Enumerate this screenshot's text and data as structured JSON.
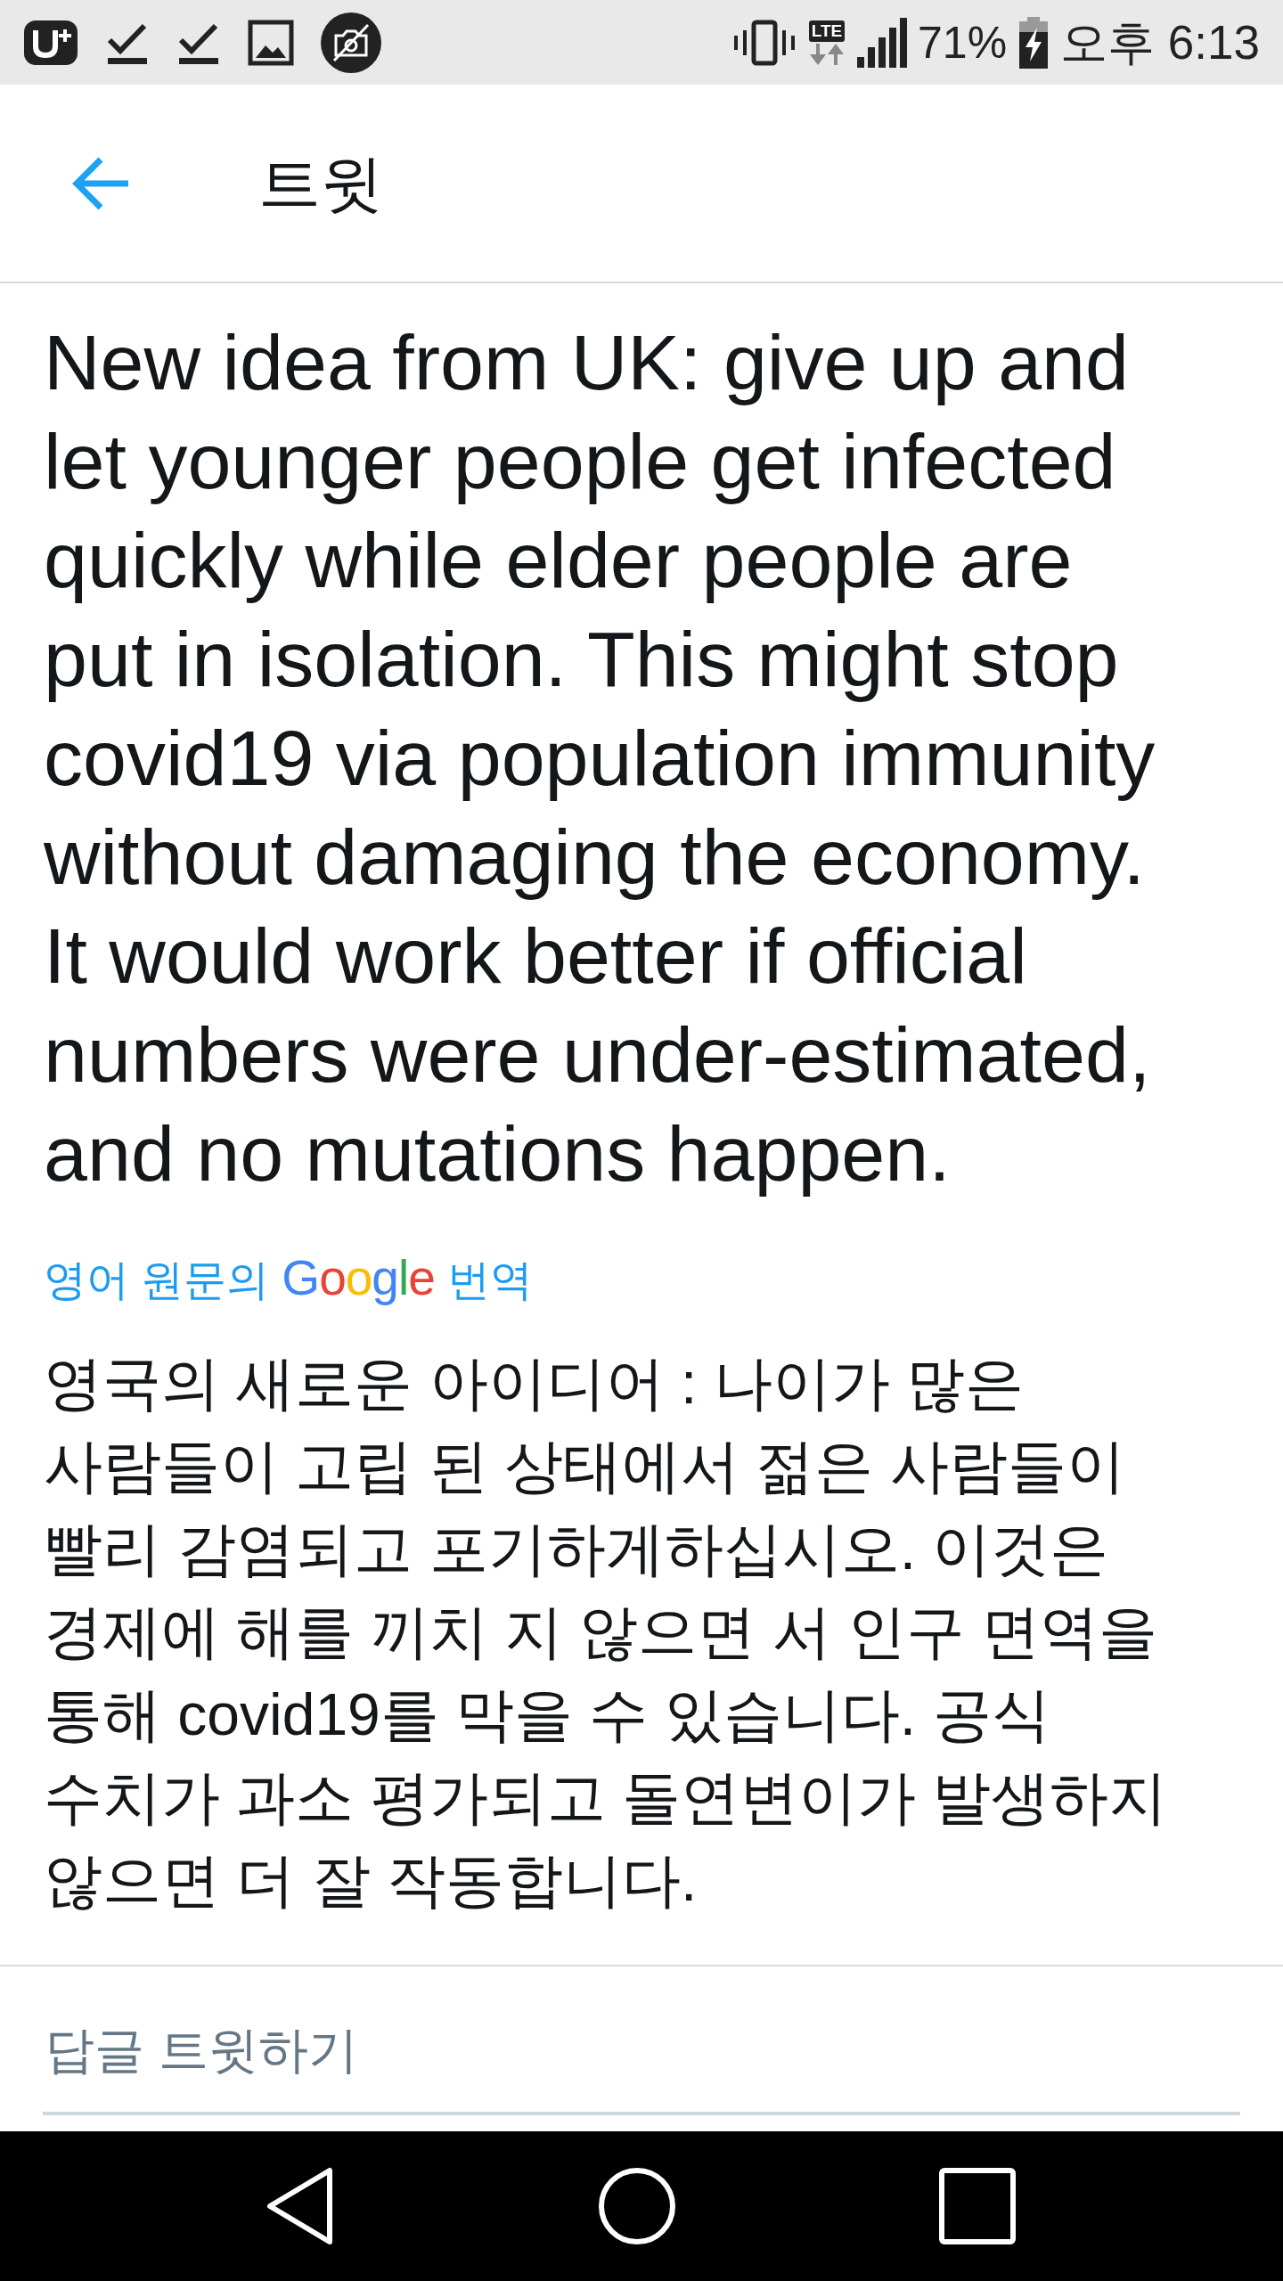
{
  "status_bar": {
    "network_type": "LTE",
    "battery": "71%",
    "time": "오후 6:13"
  },
  "header": {
    "title": "트윗"
  },
  "tweet": {
    "text": "New idea from UK: give up and let younger people get infected quickly while elder people are put in isolation. This might stop covid19 via population immunity without damaging the economy. It would work better if official numbers were under-estimated, and no mutations happen.",
    "translation_credit": {
      "prefix": "영어 원문의",
      "logo": "Google",
      "suffix": "번역"
    },
    "translated_text": "영국의 새로운 아이디어 : 나이가 많은 사람들이 고립 된 상태에서 젊은 사람들이 빨리 감염되고 포기하게하십시오. 이것은 경제에 해를 끼치 지 않으면 서 인구 면역을 통해 covid19를 막을 수 있습니다. 공식 수치가 과소 평가되고 돌연변이가 발생하지 않으면 더 잘 작동합니다."
  },
  "reply": {
    "placeholder": "답글 트윗하기"
  }
}
